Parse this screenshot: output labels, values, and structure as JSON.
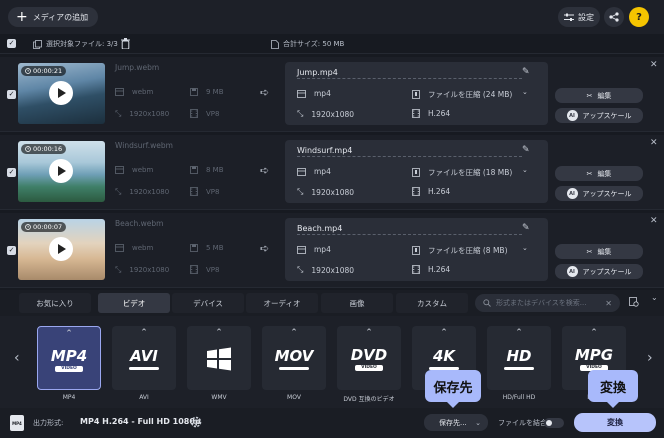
{
  "toolbar": {
    "add_media_label": "メディアの追加",
    "settings_label": "設定",
    "help_label": "?"
  },
  "selection": {
    "selected_files_label": "選択対象ファイル: 3/3",
    "total_size_label": "合計サイズ: 50 MB"
  },
  "files": [
    {
      "duration": "00:00:21",
      "source_name": "Jump.webm",
      "source_format": "webm",
      "source_size": "9 MB",
      "source_resolution": "1920x1080",
      "source_codec": "VP8",
      "output_name": "Jump.mp4",
      "output_format": "mp4",
      "compression": "ファイルを圧縮 (24 MB)",
      "output_resolution": "1920x1080",
      "output_codec": "H.264",
      "edit_label": "編集",
      "upscale_label": "アップスケール"
    },
    {
      "duration": "00:00:16",
      "source_name": "Windsurf.webm",
      "source_format": "webm",
      "source_size": "8 MB",
      "source_resolution": "1920x1080",
      "source_codec": "VP8",
      "output_name": "Windsurf.mp4",
      "output_format": "mp4",
      "compression": "ファイルを圧縮 (18 MB)",
      "output_resolution": "1920x1080",
      "output_codec": "H.264",
      "edit_label": "編集",
      "upscale_label": "アップスケール"
    },
    {
      "duration": "00:00:07",
      "source_name": "Beach.webm",
      "source_format": "webm",
      "source_size": "5 MB",
      "source_resolution": "1920x1080",
      "source_codec": "VP8",
      "output_name": "Beach.mp4",
      "output_format": "mp4",
      "compression": "ファイルを圧縮 (8 MB)",
      "output_resolution": "1920x1080",
      "output_codec": "H.264",
      "edit_label": "編集",
      "upscale_label": "アップスケール"
    }
  ],
  "format_tabs": {
    "items": [
      "お気に入り",
      "ビデオ",
      "デバイス",
      "オーディオ",
      "画像",
      "カスタム"
    ],
    "active": "ビデオ",
    "search_placeholder": "形式またはデバイスを検索..."
  },
  "formats": [
    {
      "logo": "MP4",
      "sub": "VIDEO",
      "label": "MP4",
      "selected": true
    },
    {
      "logo": "AVI",
      "sub": "",
      "label": "AVI",
      "selected": false
    },
    {
      "logo": "",
      "sub": "",
      "label": "WMV",
      "selected": false,
      "icon": "windows-icon"
    },
    {
      "logo": "MOV",
      "sub": "",
      "label": "MOV",
      "selected": false
    },
    {
      "logo": "DVD",
      "sub": "VIDEO",
      "label": "DVD 互換のビデオ",
      "selected": false
    },
    {
      "logo": "4K",
      "sub": "",
      "label": "4K",
      "selected": false
    },
    {
      "logo": "HD",
      "sub": "",
      "label": "HD/Full HD",
      "selected": false
    },
    {
      "logo": "MPG",
      "sub": "VIDEO",
      "label": "MPG",
      "selected": false
    }
  ],
  "bottom": {
    "output_format_label": "出力形式:",
    "output_format_value": "MP4 H.264 - Full HD 1080p",
    "save_to_label": "保存先...",
    "merge_label": "ファイルを結合:",
    "convert_label": "変換"
  },
  "callouts": {
    "save_to": "保存先",
    "convert": "変換"
  },
  "colors": {
    "accent": "#b7c4fb",
    "callout": "#a8b9fb",
    "selected_format": "#394378",
    "help": "#f5c400"
  }
}
